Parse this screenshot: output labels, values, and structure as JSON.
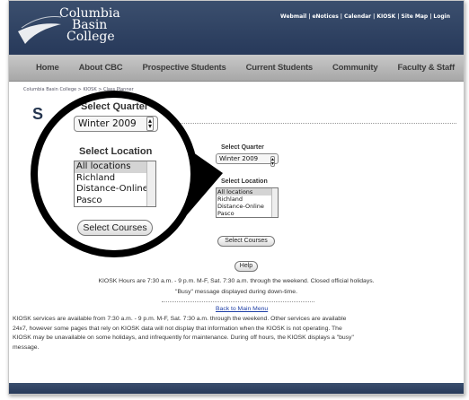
{
  "header": {
    "logo_line1": "Columbia",
    "logo_line2": "Basin",
    "logo_line3": "College",
    "links": [
      "Webmail",
      "|",
      "eNotices",
      "|",
      "Calendar",
      "|",
      "KIOSK",
      "|",
      "Site Map",
      "|",
      "Login"
    ]
  },
  "nav": {
    "items": [
      "Home",
      "About CBC",
      "Prospective Students",
      "Current Students",
      "Community",
      "Faculty & Staff"
    ]
  },
  "breadcrumb": "Columbia Basin College > KIOSK > Class Planner",
  "page_title": "S",
  "form": {
    "quarter_label": "Select Quarter",
    "quarter_value": "Winter 2009",
    "location_label": "Select Location",
    "locations": [
      "All locations",
      "Richland",
      "Distance-Online",
      "Pasco"
    ],
    "selected_location": "All locations",
    "select_courses": "Select Courses",
    "help": "Help"
  },
  "notes": {
    "hours": "KIOSK Hours are 7:30 a.m. - 9 p.m. M-F, Sat. 7:30 a.m. through the weekend.  Closed official holidays.",
    "busy": "\"Busy\" message displayed during down-time.",
    "back_link": "Back to Main Menu",
    "services_line1": "KIOSK services are available from 7:30 a.m. - 9 p.m. M-F, Sat. 7:30 a.m. through the weekend. Other services are available",
    "services_line2": "24x7, however some pages that rely on KIOSK data will not display that information when the KIOSK is not operating. The",
    "services_line3": "KIOSK may be unavailable on some holidays, and infrequently for maintenance.  During off hours, the KIOSK displays a \"busy\"",
    "services_line4": "message."
  },
  "colors": {
    "header_bg": "#2f4263",
    "link": "#1f3fa6"
  }
}
